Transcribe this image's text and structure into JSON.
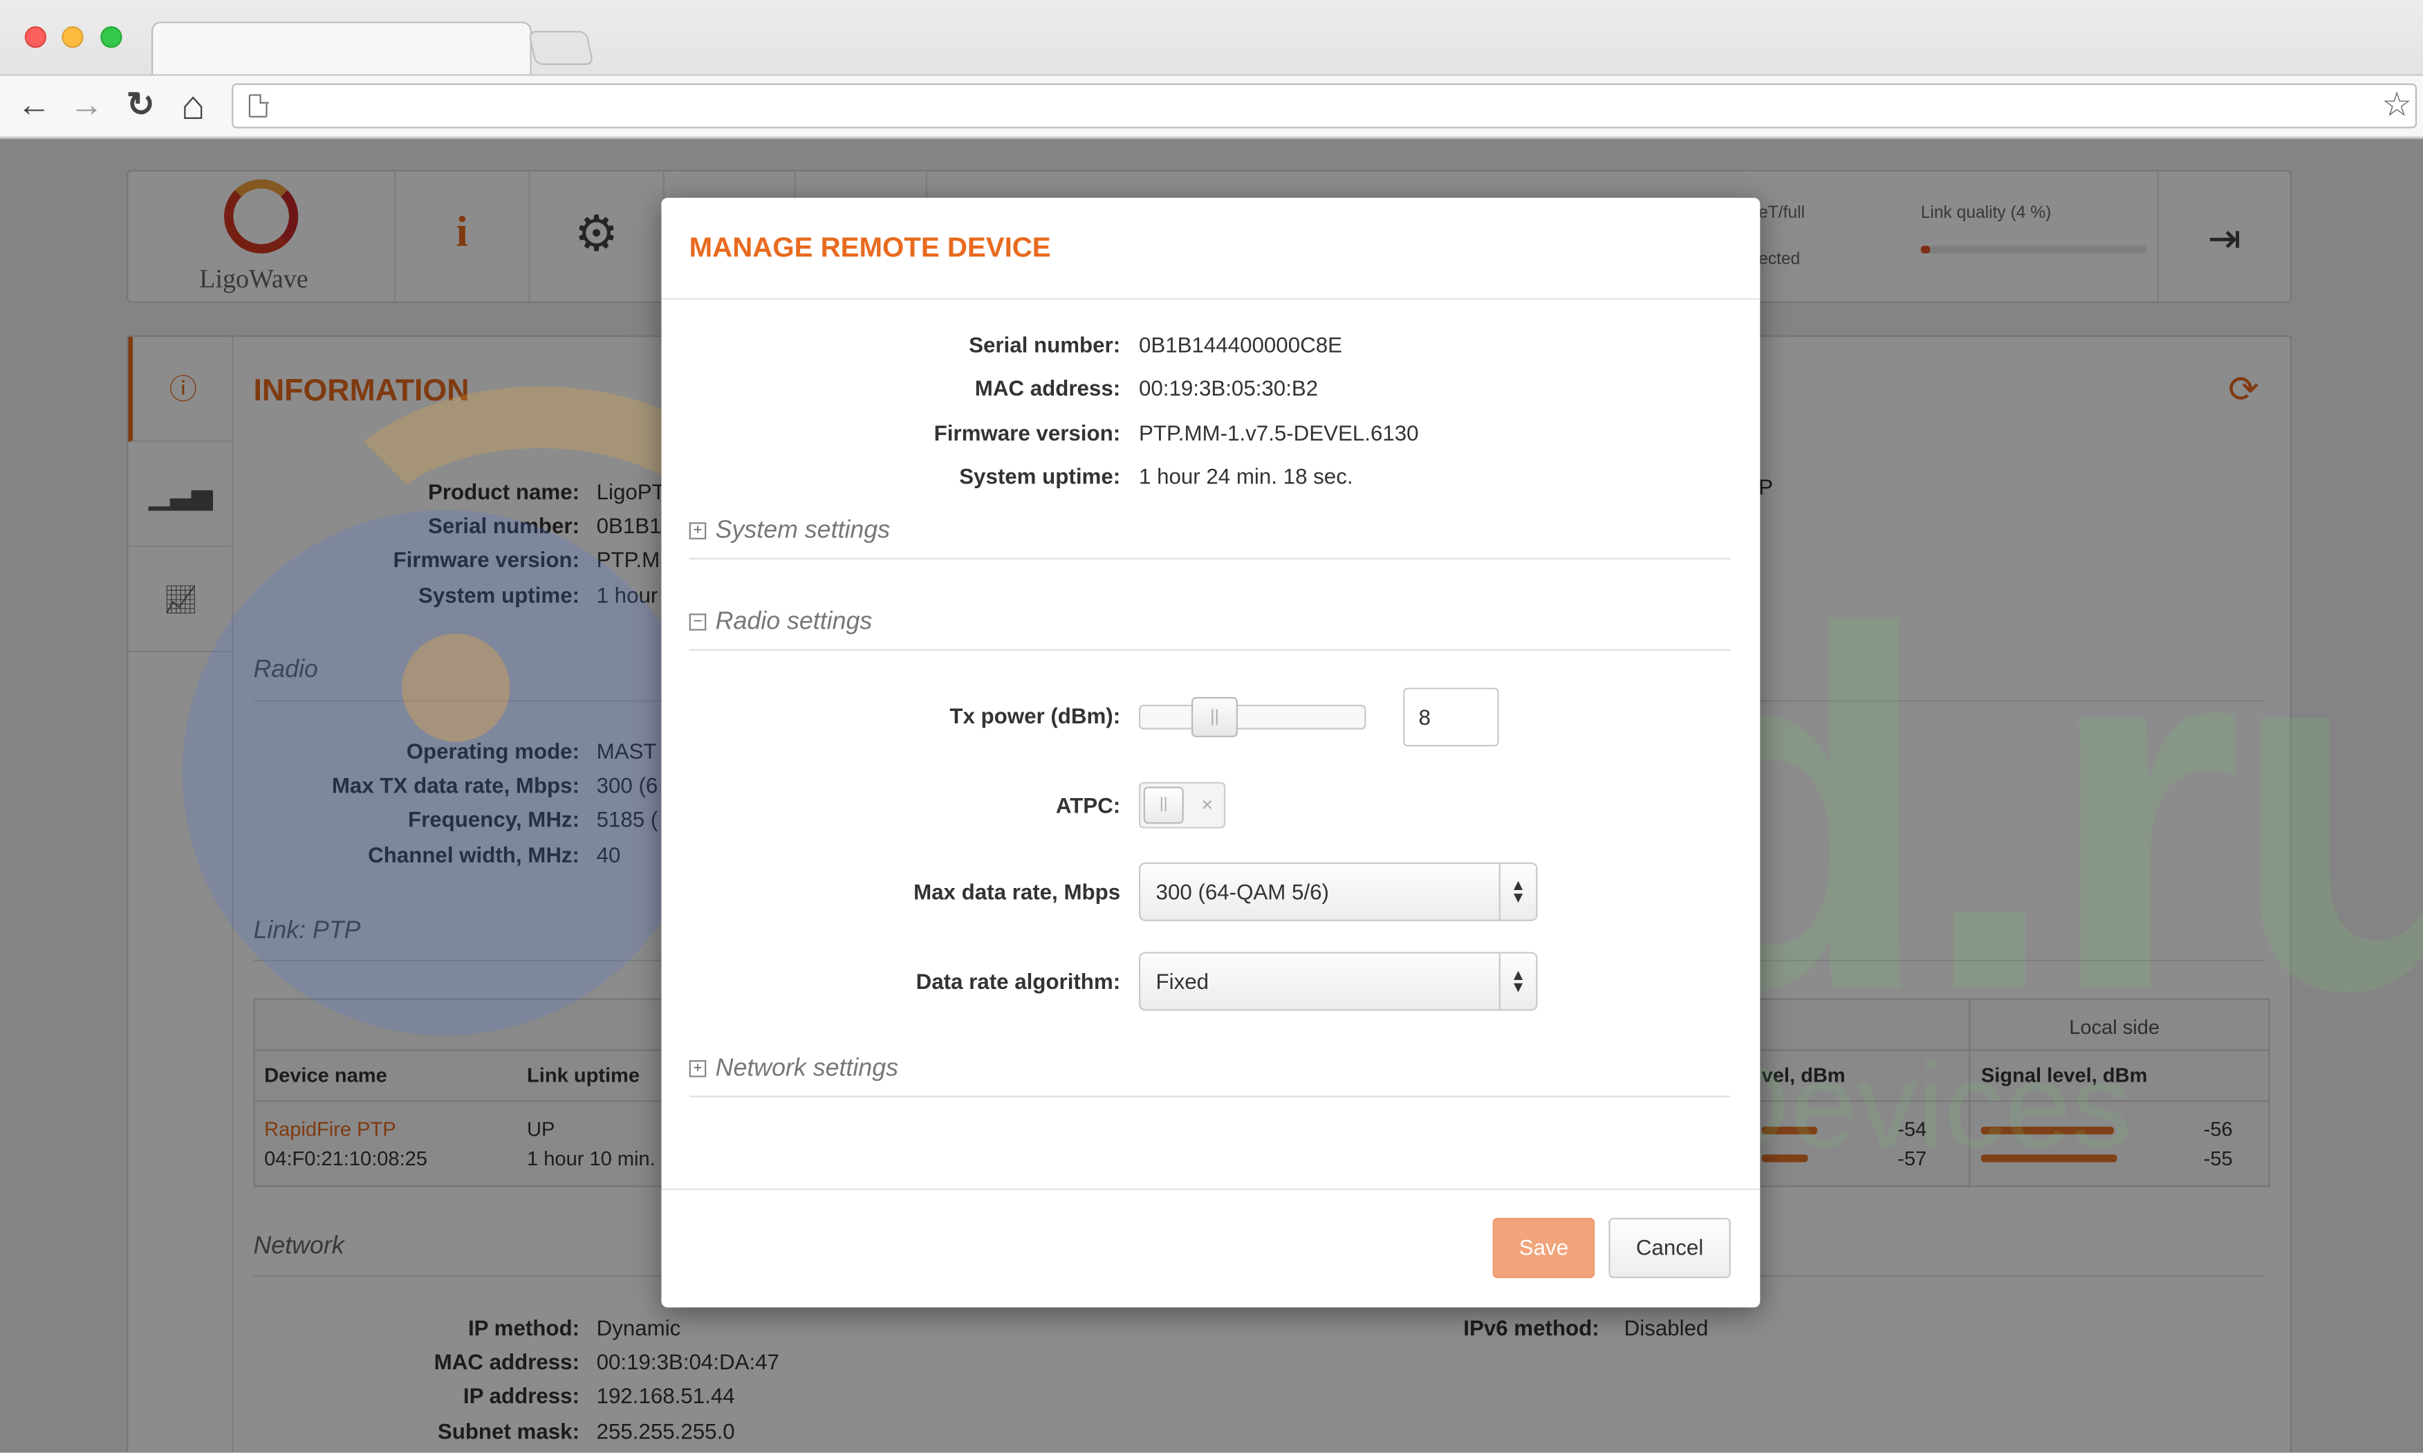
{
  "browser": {
    "back_icon": "←",
    "forward_icon": "→",
    "reload_icon": "↻",
    "home_icon": "⌂",
    "star_icon": "☆"
  },
  "header": {
    "logo_text": "LigoWave",
    "info_icon": "i",
    "gear_icon": "⚙",
    "ethernet_partial": "eT/full",
    "connection_partial": "ected",
    "link_quality_label": "Link quality (4 %)",
    "link_quality_fraction": 0.04,
    "logout_icon": "⇥"
  },
  "background_page": {
    "title": "INFORMATION",
    "general": [
      {
        "key": "Product name:",
        "value": "LigoPT"
      },
      {
        "key": "Serial number:",
        "value": "0B1B1"
      },
      {
        "key": "Firmware version:",
        "value": "PTP.M"
      },
      {
        "key": "System uptime:",
        "value": "1 hour"
      }
    ],
    "radio_heading": "Radio",
    "radio": [
      {
        "key": "Operating mode:",
        "value": "MAST"
      },
      {
        "key": "Max TX data rate, Mbps:",
        "value": "300 (6"
      },
      {
        "key": "Frequency, MHz:",
        "value": "5185 ("
      },
      {
        "key": "Channel width, MHz:",
        "value": "40"
      }
    ],
    "link_heading": "Link: PTP",
    "stray_p": "P",
    "table": {
      "local_side": "Local side",
      "headers": [
        "Device name",
        "Link uptime",
        "vel, dBm",
        "Signal level, dBm"
      ],
      "device_name": "RapidFire PTP",
      "device_mac": "04:F0:21:10:08:25",
      "link_status": "UP",
      "link_uptime": "1 hour 10 min.",
      "remote_levels": [
        "-54",
        "-57"
      ],
      "local_levels": [
        "-56",
        "-55"
      ]
    },
    "network_heading": "Network",
    "network": [
      {
        "key": "IP method:",
        "value": "Dynamic"
      },
      {
        "key": "MAC address:",
        "value": "00:19:3B:04:DA:47"
      },
      {
        "key": "IP address:",
        "value": "192.168.51.44"
      },
      {
        "key": "Subnet mask:",
        "value": "255.255.255.0"
      }
    ],
    "ipv6_key": "IPv6 method:",
    "ipv6_value": "Disabled"
  },
  "watermark": {
    "big": "wmd.ru",
    "sub": "Wireless Mobile Devices"
  },
  "modal": {
    "title": "MANAGE REMOTE DEVICE",
    "info": [
      {
        "key": "Serial number:",
        "value": "0B1B144400000C8E"
      },
      {
        "key": "MAC address:",
        "value": "00:19:3B:05:30:B2"
      },
      {
        "key": "Firmware version:",
        "value": "PTP.MM-1.v7.5-DEVEL.6130"
      },
      {
        "key": "System uptime:",
        "value": "1 hour 24 min. 18 sec."
      }
    ],
    "system_settings": "System settings",
    "radio_settings": "Radio settings",
    "network_settings": "Network settings",
    "tx_power_label": "Tx power (dBm):",
    "tx_power_value": "8",
    "atpc_label": "ATPC:",
    "max_rate_label": "Max data rate, Mbps",
    "max_rate_value": "300 (64-QAM 5/6)",
    "algorithm_label": "Data rate algorithm:",
    "algorithm_value": "Fixed",
    "save": "Save",
    "cancel": "Cancel"
  }
}
